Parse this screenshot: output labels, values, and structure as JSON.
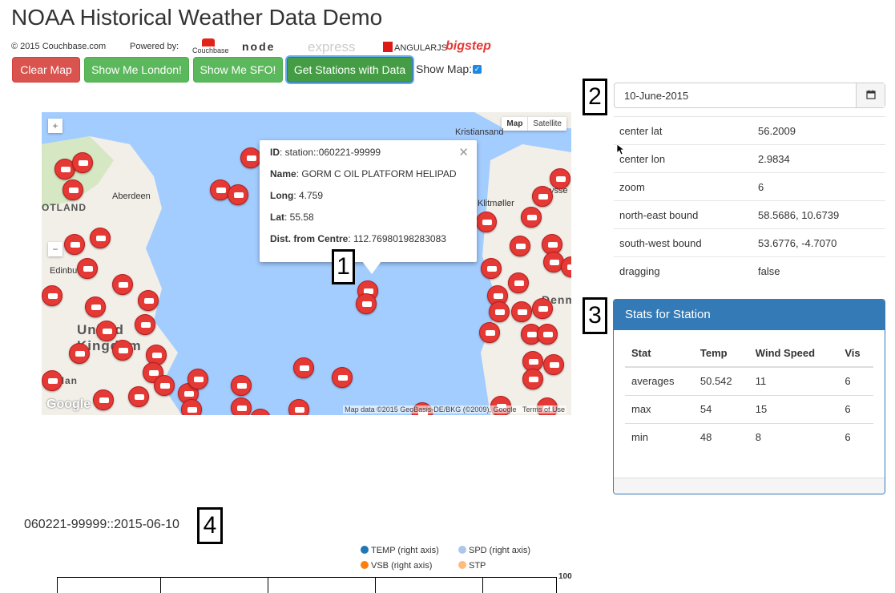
{
  "header": {
    "title": "NOAA Historical Weather Data Demo",
    "copyright": "© 2015 Couchbase.com",
    "powered_by": "Powered by:",
    "logos": [
      "Couchbase",
      "node",
      "express",
      "ANGULARJS",
      "bigstep"
    ]
  },
  "toolbar": {
    "clear_map": "Clear Map",
    "show_london": "Show Me London!",
    "show_sfo": "Show Me SFO!",
    "get_stations": "Get Stations with Data",
    "show_map_label": "Show Map:",
    "show_map_checked": true
  },
  "map": {
    "type_map": "Map",
    "type_satellite": "Satellite",
    "zoom_in": "+",
    "zoom_out": "−",
    "places": [
      "Kristiansand",
      "Aberdeen",
      "OTLAND",
      "Edinburgh",
      "gow",
      "United Kingdom",
      "Man",
      "Klitmøller",
      "Denm",
      "ysse"
    ],
    "attribution": "Map data ©2015 GeoBasis-DE/BKG (©2009), Google",
    "terms": "Terms of Use",
    "google": "Google",
    "info_window": {
      "id_label": "ID",
      "id_value": "station::060221-99999",
      "name_label": "Name",
      "name_value": "GORM C OIL PLATFORM HELIPAD",
      "long_label": "Long",
      "long_value": "4.759",
      "lat_label": "Lat",
      "lat_value": "55.58",
      "dist_label": "Dist. from Centre",
      "dist_value": "112.76980198283083"
    }
  },
  "callouts": [
    "1",
    "2",
    "3",
    "4"
  ],
  "date_picker": {
    "value": "10-June-2015",
    "icon": "calendar-icon"
  },
  "map_info": [
    {
      "key": "center lat",
      "value": "56.2009"
    },
    {
      "key": "center lon",
      "value": "2.9834"
    },
    {
      "key": "zoom",
      "value": "6"
    },
    {
      "key": "north-east bound",
      "value": "58.5686, 10.6739"
    },
    {
      "key": "south-west bound",
      "value": "53.6776, -4.7070"
    },
    {
      "key": "dragging",
      "value": "false"
    }
  ],
  "stats_panel": {
    "title": "Stats for Station",
    "headers": [
      "Stat",
      "Temp",
      "Wind Speed",
      "Vis"
    ],
    "rows": [
      [
        "averages",
        "50.542",
        "11",
        "6"
      ],
      [
        "max",
        "54",
        "15",
        "6"
      ],
      [
        "min",
        "48",
        "8",
        "6"
      ]
    ]
  },
  "chart": {
    "title": "060221-99999::2015-06-10",
    "legend": [
      {
        "label": "TEMP (right axis)",
        "color": "#1f77b4"
      },
      {
        "label": "SPD (right axis)",
        "color": "#aec7e8"
      },
      {
        "label": "VSB (right axis)",
        "color": "#ff7f0e"
      },
      {
        "label": "STP",
        "color": "#ffbb78"
      }
    ],
    "axis_top": "100"
  }
}
